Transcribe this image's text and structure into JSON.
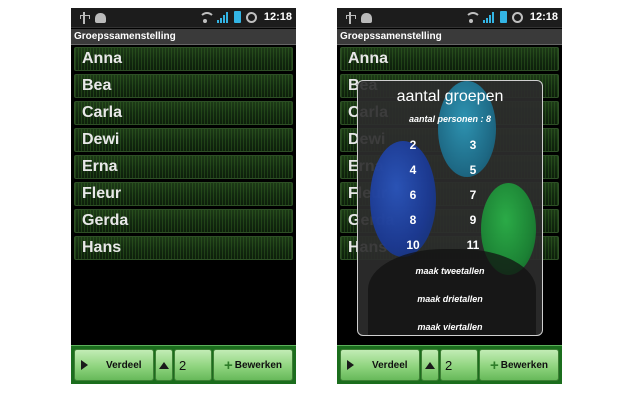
{
  "status_bar": {
    "time": "12:18"
  },
  "app": {
    "title": "Groepssamenstelling"
  },
  "names": [
    "Anna",
    "Bea",
    "Carla",
    "Dewi",
    "Erna",
    "Fleur",
    "Gerda",
    "Hans"
  ],
  "bottom_bar": {
    "verdeel_label": "Verdeel",
    "group_count": "2",
    "edit_label": "Bewerken"
  },
  "dialog": {
    "title": "aantal groepen",
    "subtitle": "aantal personen : 8",
    "numbers": [
      "2",
      "3",
      "4",
      "5",
      "6",
      "7",
      "8",
      "9",
      "10",
      "11"
    ],
    "options": [
      "maak tweetallen",
      "maak drietallen",
      "maak viertallen"
    ]
  },
  "colors": {
    "list_row": "#1d3a17",
    "bottom_bar": "#1b6d1d",
    "button": "#8fd47e",
    "dialog_bg": "#2d2d2d"
  }
}
